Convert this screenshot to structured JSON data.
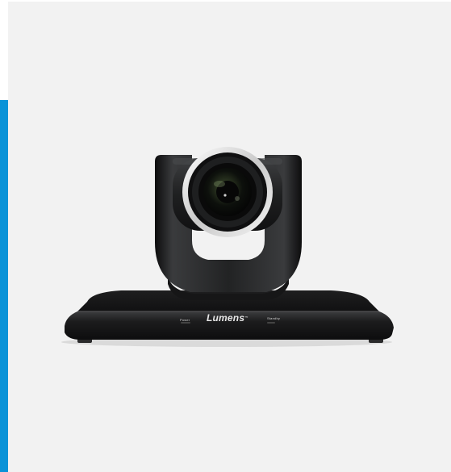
{
  "product": {
    "brand": "Lumens",
    "trademark": "™",
    "power_label": "Power",
    "standby_label": "Standby"
  },
  "colors": {
    "accent": "#0a93d8",
    "background": "#f2f2f2",
    "body": "#1b1b1c"
  },
  "icons": [
    "ptz-camera-image"
  ]
}
